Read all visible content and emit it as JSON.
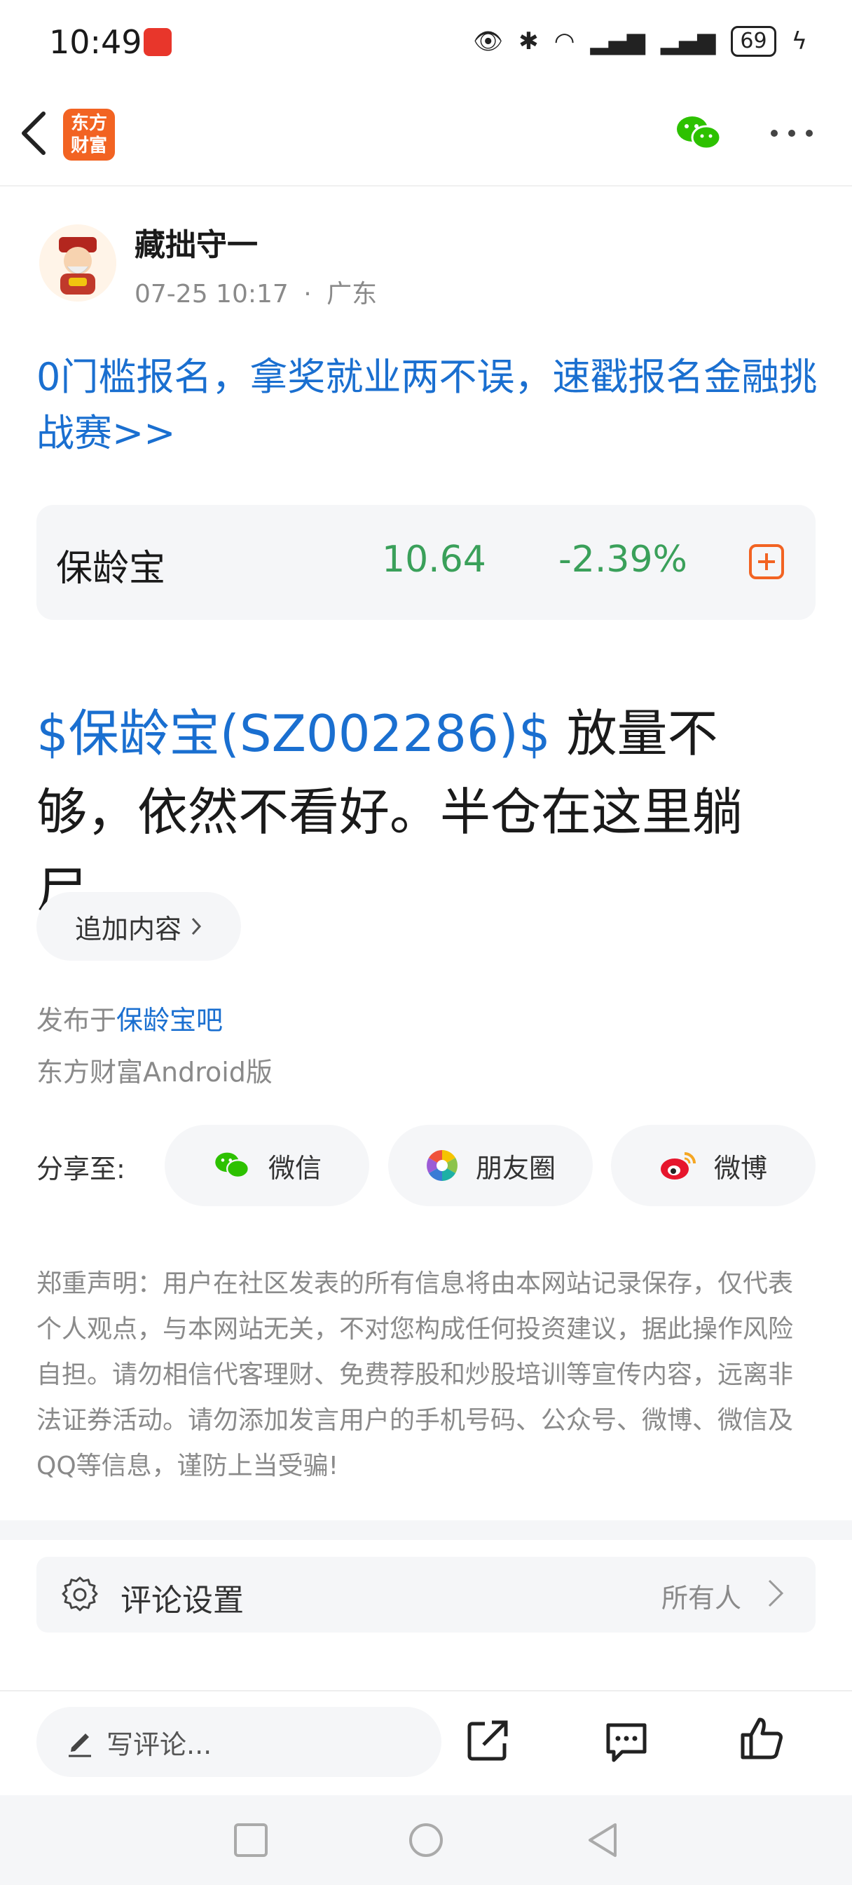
{
  "status_bar": {
    "time": "10:49",
    "battery": "69"
  },
  "nav": {
    "logo_text": "东方\n财富"
  },
  "author": {
    "name": "藏拙守一",
    "date": "07-25 10:17",
    "sep": "·",
    "location": "广东"
  },
  "promo": {
    "text": "0门槛报名，拿奖就业两不误，速戳报名金融挑战赛>>"
  },
  "stock": {
    "name": "保龄宝",
    "price": "10.64",
    "change": "-2.39%"
  },
  "post": {
    "stock_tag": "$保龄宝(SZ002286)$",
    "text": " 放量不够，依然不看好。半仓在这里躺尸。"
  },
  "append_button": {
    "label": "追加内容"
  },
  "published": {
    "prefix": "发布于",
    "bar_name": "保龄宝吧",
    "client": "东方财富Android版"
  },
  "share": {
    "label": "分享至:",
    "wechat": "微信",
    "moments": "朋友圈",
    "weibo": "微博"
  },
  "disclaimer": "郑重声明：用户在社区发表的所有信息将由本网站记录保存，仅代表个人观点，与本网站无关，不对您构成任何投资建议，据此操作风险自担。请勿相信代客理财、免费荐股和炒股培训等宣传内容，远离非法证券活动。请勿添加发言用户的手机号码、公众号、微博、微信及QQ等信息，谨防上当受骗!",
  "comment_settings": {
    "label": "评论设置",
    "value": "所有人"
  },
  "bottom_bar": {
    "comment_placeholder": "写评论..."
  },
  "colors": {
    "link_blue": "#1a6fd0",
    "stock_green": "#3aa05a",
    "brand_orange": "#f26322"
  }
}
